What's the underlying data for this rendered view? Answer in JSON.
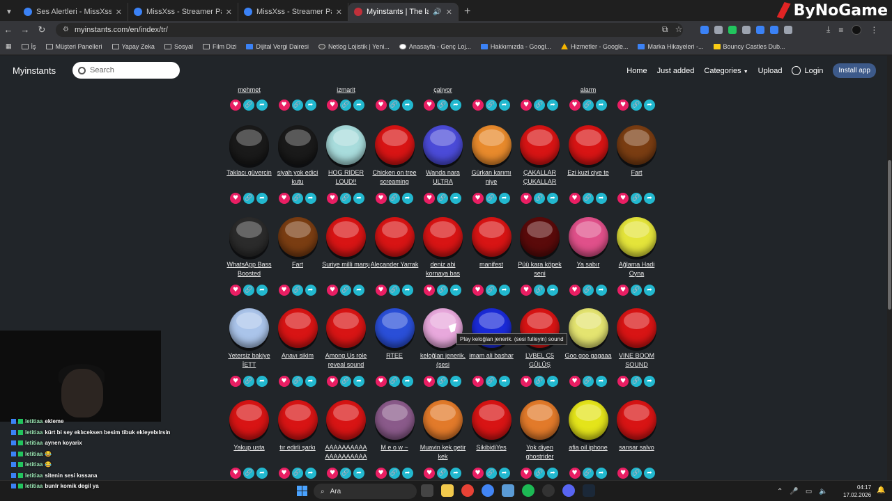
{
  "browser": {
    "tabs": [
      {
        "label": "Ses Alertleri - MissXss AI Bot Sy",
        "favicon": "blue"
      },
      {
        "label": "MissXss - Streamer Panel",
        "favicon": "blue"
      },
      {
        "label": "MissXss - Streamer Panel",
        "favicon": "blue"
      },
      {
        "label": "Myinstants | The largest inst",
        "favicon": "red",
        "active": true
      }
    ],
    "url": "myinstants.com/en/index/tr/",
    "watermark": "ByNoGame"
  },
  "bookmarks": [
    {
      "label": "İş",
      "icon": "folder"
    },
    {
      "label": "Müşteri Panelleri",
      "icon": "folder"
    },
    {
      "label": "Yapay Zeka",
      "icon": "folder"
    },
    {
      "label": "Sosyal",
      "icon": "folder"
    },
    {
      "label": "Film Dizi",
      "icon": "folder"
    },
    {
      "label": "Dijital Vergi Dairesi",
      "icon": "doc"
    },
    {
      "label": "Netlog Lojistik | Yeni...",
      "icon": "dot"
    },
    {
      "label": "Anasayfa - Genç Loj...",
      "icon": "google"
    },
    {
      "label": "Hakkımızda - Googl...",
      "icon": "doc"
    },
    {
      "label": "Hizmetler - Google...",
      "icon": "drive"
    },
    {
      "label": "Marka Hikayeleri -...",
      "icon": "doc"
    },
    {
      "label": "Bouncy Castles Dub...",
      "icon": "flag"
    }
  ],
  "site": {
    "brand": "Myinstants",
    "search_placeholder": "Search",
    "nav": {
      "home": "Home",
      "just_added": "Just added",
      "categories": "Categories",
      "upload": "Upload",
      "login": "Login",
      "install": "Install app"
    }
  },
  "top_row": [
    "mehmet",
    "",
    "izmarit",
    "",
    "çalıyor",
    "",
    "",
    "alarm",
    ""
  ],
  "rows": [
    [
      {
        "title": "Taklacı güvercin",
        "color": "#1a1a1a"
      },
      {
        "title": "siyah yok edici kutu",
        "color": "#1a1a1a"
      },
      {
        "title": "HOG RIDER LOUD!!",
        "color": "#a8dcdc"
      },
      {
        "title": "Chicken on tree screaming",
        "color": "#d81414"
      },
      {
        "title": "Wanda nara ULTRA",
        "color": "#4b4bd8"
      },
      {
        "title": "Gürkan karımı niye",
        "color": "#e88a2c"
      },
      {
        "title": "ÇAKALLAR ÇUKALLAR",
        "color": "#d81414"
      },
      {
        "title": "Ezi kuzi ciye te",
        "color": "#d81414"
      },
      {
        "title": "Fart",
        "color": "#7a3d12"
      }
    ],
    [
      {
        "title": "WhatsApp Bass Boosted",
        "color": "#2b2b2b"
      },
      {
        "title": "Fart",
        "color": "#7a3d12"
      },
      {
        "title": "Suriye milli marşı",
        "color": "#d81414"
      },
      {
        "title": "Alecander Yarrak",
        "color": "#d81414"
      },
      {
        "title": "deniz abi kornaya bas",
        "color": "#d81414"
      },
      {
        "title": "manifest",
        "color": "#d81414"
      },
      {
        "title": "Püü kara köpek seni",
        "color": "#5a0a0a"
      },
      {
        "title": "Ya sabır",
        "color": "#e0508a"
      },
      {
        "title": "Ağlama Hadi Oyna",
        "color": "#e4e43a"
      }
    ],
    [
      {
        "title": "Yetersiz bakiye İETT",
        "color": "#aac4ea"
      },
      {
        "title": "Anavı sikim",
        "color": "#d81414"
      },
      {
        "title": "Among Us role reveal sound",
        "color": "#d81414"
      },
      {
        "title": "RTEE",
        "color": "#2a4fd8"
      },
      {
        "title": "keloğlan jenerik. (sesi",
        "color": "#e8a8dc"
      },
      {
        "title": "imam ali bashar",
        "color": "#1a2ad8"
      },
      {
        "title": "LVBEL C5 GÜLÜŞ",
        "color": "#d81414"
      },
      {
        "title": "Goo goo gagaaa",
        "color": "#e4e470"
      },
      {
        "title": "VINE BOOM SOUND",
        "color": "#d81414"
      }
    ],
    [
      {
        "title": "Yakup usta",
        "color": "#d81414"
      },
      {
        "title": "tır edirli şarkı",
        "color": "#d81414"
      },
      {
        "title": "AAAAAAAAAA AAAAAAAAAA",
        "color": "#d81414"
      },
      {
        "title": "M e o w ~",
        "color": "#8a5a8a"
      },
      {
        "title": "Muavin kek getir kek",
        "color": "#e27a2a"
      },
      {
        "title": "SikibidiYes",
        "color": "#d81414"
      },
      {
        "title": "Yok diyen ghostrider",
        "color": "#e27a2a"
      },
      {
        "title": "afia oil iphone",
        "color": "#e4e41a"
      },
      {
        "title": "sansar salvo",
        "color": "#d81414"
      }
    ]
  ],
  "tooltip": "Play keloğlan jenerik. (sesi fulleyin) sound",
  "chat": [
    {
      "user": "letitiaa",
      "msg": "ekleme"
    },
    {
      "user": "letitiaa",
      "msg": "kürt bi sey eklıceksen besim tibuk ekleyebılrsin"
    },
    {
      "user": "letitiaa",
      "msg": "aynen koyarix"
    },
    {
      "user": "letitiaa",
      "msg": "😂"
    },
    {
      "user": "letitiaa",
      "msg": "😂"
    },
    {
      "user": "letitiaa",
      "msg": "sitenin sesi kıssana"
    },
    {
      "user": "letitiaa",
      "msg": "bunlr komik degil ya"
    }
  ],
  "taskbar": {
    "search_placeholder": "Ara",
    "time": "04:17",
    "date": "17.02.2026"
  }
}
